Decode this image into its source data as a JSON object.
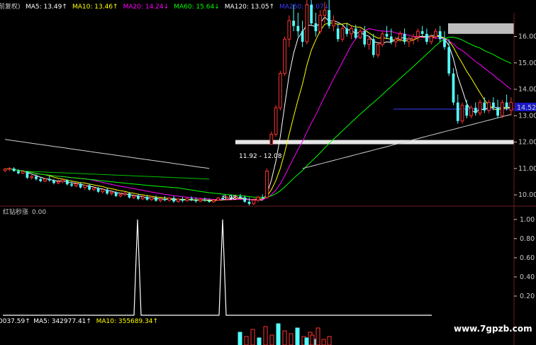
{
  "header": {
    "period_label": "前复权)",
    "ma_items": [
      {
        "label": "MA5: 13.49",
        "arrow": "↑",
        "color": "#ffffff"
      },
      {
        "label": "MA10: 13.46",
        "arrow": "↑",
        "color": "#ffff00"
      },
      {
        "label": "MA20: 14.24",
        "arrow": "↓",
        "color": "#ff00ff"
      },
      {
        "label": "MA60: 15.64",
        "arrow": "↓",
        "color": "#00ff00"
      },
      {
        "label": "MA120: 13.05",
        "arrow": "↑",
        "color": "#ffffff"
      },
      {
        "label": "MA250: 13.07",
        "arrow": "↓",
        "color": "#3b3bff"
      }
    ]
  },
  "price_axis": {
    "ticks": [
      "16.00",
      "15.00",
      "14.00",
      "13.00",
      "12.00",
      "11.00",
      "10.00"
    ],
    "current_price": "14.52",
    "range": [
      9.6,
      16.9
    ]
  },
  "annotations": {
    "low_label": "8.98",
    "gap_label": "11.92 - 12.08"
  },
  "indicator": {
    "title": "红钻秒涨",
    "value": "0.00",
    "ticks": [
      "1.00",
      "0.80",
      "0.60",
      "0.40",
      "0.20"
    ],
    "spikes": [
      {
        "bar_index": 38,
        "value": 1.0
      },
      {
        "bar_index": 62,
        "value": 1.0
      }
    ]
  },
  "volume": {
    "items": [
      {
        "label": "0037.59",
        "arrow": "↑",
        "color": "#ffffff"
      },
      {
        "label": "MA5: 342977.41",
        "arrow": "↑",
        "color": "#ffffff"
      },
      {
        "label": "MA10: 355689.34",
        "arrow": "↑",
        "color": "#ffff00"
      }
    ]
  },
  "watermark": "www.7gpzb.com",
  "chart_data": {
    "type": "candlestick",
    "colors": {
      "up": "#ff3232",
      "down": "#54fcfc",
      "ma5": "#ffffff",
      "ma10": "#ffff00",
      "ma20": "#ff00ff",
      "ma60": "#00ff00",
      "ma120": "#ffffff",
      "ma250": "#3b3bff"
    },
    "candles": [
      [
        10.92,
        11.02,
        10.86,
        10.98
      ],
      [
        10.98,
        11.06,
        10.9,
        11.0
      ],
      [
        11.0,
        11.05,
        10.88,
        10.9
      ],
      [
        10.9,
        10.98,
        10.78,
        10.82
      ],
      [
        10.82,
        10.94,
        10.8,
        10.88
      ],
      [
        10.88,
        10.9,
        10.6,
        10.65
      ],
      [
        10.65,
        10.75,
        10.58,
        10.7
      ],
      [
        10.7,
        10.78,
        10.55,
        10.6
      ],
      [
        10.6,
        10.68,
        10.48,
        10.52
      ],
      [
        10.52,
        10.64,
        10.48,
        10.6
      ],
      [
        10.6,
        10.7,
        10.5,
        10.55
      ],
      [
        10.55,
        10.6,
        10.4,
        10.45
      ],
      [
        10.45,
        10.58,
        10.4,
        10.5
      ],
      [
        10.5,
        10.62,
        10.44,
        10.56
      ],
      [
        10.56,
        10.6,
        10.36,
        10.4
      ],
      [
        10.4,
        10.5,
        10.3,
        10.35
      ],
      [
        10.35,
        10.46,
        10.28,
        10.42
      ],
      [
        10.42,
        10.48,
        10.24,
        10.28
      ],
      [
        10.28,
        10.4,
        10.2,
        10.36
      ],
      [
        10.36,
        10.42,
        10.16,
        10.2
      ],
      [
        10.2,
        10.32,
        10.14,
        10.26
      ],
      [
        10.26,
        10.3,
        10.08,
        10.12
      ],
      [
        10.12,
        10.24,
        10.05,
        10.2
      ],
      [
        10.2,
        10.26,
        10.0,
        10.05
      ],
      [
        10.05,
        10.18,
        9.98,
        10.1
      ],
      [
        10.1,
        10.15,
        9.92,
        9.96
      ],
      [
        9.96,
        10.08,
        9.9,
        10.02
      ],
      [
        10.02,
        10.12,
        9.95,
        10.06
      ],
      [
        10.06,
        10.1,
        9.86,
        9.9
      ],
      [
        9.9,
        10.02,
        9.84,
        9.96
      ],
      [
        9.96,
        10.05,
        9.8,
        9.85
      ],
      [
        9.85,
        9.98,
        9.8,
        9.92
      ],
      [
        9.92,
        10.0,
        9.78,
        9.82
      ],
      [
        9.82,
        9.96,
        9.78,
        9.9
      ],
      [
        9.9,
        9.98,
        9.74,
        9.78
      ],
      [
        9.78,
        9.9,
        9.72,
        9.84
      ],
      [
        9.84,
        9.95,
        9.76,
        9.8
      ],
      [
        9.8,
        9.92,
        9.74,
        9.88
      ],
      [
        9.88,
        9.96,
        9.7,
        9.75
      ],
      [
        9.75,
        9.88,
        9.7,
        9.84
      ],
      [
        9.84,
        9.92,
        9.72,
        9.78
      ],
      [
        9.78,
        9.9,
        9.74,
        9.86
      ],
      [
        9.86,
        9.94,
        9.76,
        9.8
      ],
      [
        9.8,
        9.9,
        9.7,
        9.76
      ],
      [
        9.76,
        9.88,
        9.72,
        9.82
      ],
      [
        9.82,
        9.9,
        9.74,
        9.78
      ],
      [
        9.78,
        9.86,
        9.7,
        9.74
      ],
      [
        9.74,
        9.84,
        9.7,
        9.8
      ],
      [
        9.8,
        9.92,
        9.76,
        9.88
      ],
      [
        9.88,
        9.98,
        9.8,
        9.84
      ],
      [
        9.84,
        9.96,
        9.78,
        9.9
      ],
      [
        9.9,
        10.0,
        9.82,
        9.86
      ],
      [
        9.86,
        9.98,
        9.8,
        9.94
      ],
      [
        9.94,
        10.04,
        9.86,
        9.9
      ],
      [
        9.9,
        9.98,
        9.7,
        9.74
      ],
      [
        9.74,
        9.9,
        9.6,
        9.66
      ],
      [
        9.66,
        9.86,
        9.62,
        9.8
      ],
      [
        9.8,
        9.96,
        9.72,
        9.92
      ],
      [
        9.92,
        10.02,
        9.84,
        9.9
      ],
      [
        9.9,
        11.0,
        9.88,
        10.9
      ],
      [
        11.92,
        12.4,
        11.9,
        12.3
      ],
      [
        12.3,
        13.4,
        12.2,
        13.3
      ],
      [
        13.3,
        14.7,
        13.2,
        14.6
      ],
      [
        14.6,
        16.0,
        14.5,
        15.9
      ],
      [
        15.9,
        16.8,
        15.6,
        16.6
      ],
      [
        16.6,
        17.2,
        16.2,
        16.4
      ],
      [
        16.4,
        16.9,
        16.0,
        16.2
      ],
      [
        16.2,
        16.6,
        15.6,
        15.8
      ],
      [
        15.8,
        17.4,
        15.7,
        17.2
      ],
      [
        17.2,
        17.6,
        16.4,
        16.5
      ],
      [
        16.5,
        16.9,
        16.0,
        16.2
      ],
      [
        16.2,
        17.0,
        16.1,
        16.8
      ],
      [
        16.8,
        17.3,
        16.5,
        17.0
      ],
      [
        17.0,
        17.4,
        16.3,
        16.4
      ],
      [
        16.4,
        16.8,
        16.2,
        16.6
      ],
      [
        16.3,
        16.5,
        15.8,
        15.9
      ],
      [
        15.9,
        16.4,
        15.8,
        16.3
      ],
      [
        16.3,
        16.5,
        16.0,
        16.1
      ],
      [
        16.1,
        16.4,
        15.9,
        16.3
      ],
      [
        16.3,
        16.45,
        15.9,
        15.95
      ],
      [
        15.95,
        16.3,
        15.9,
        16.2
      ],
      [
        16.2,
        16.4,
        15.6,
        15.7
      ],
      [
        15.7,
        16.0,
        15.5,
        15.9
      ],
      [
        15.9,
        16.1,
        15.2,
        15.3
      ],
      [
        15.3,
        15.8,
        15.2,
        15.7
      ],
      [
        15.7,
        16.2,
        15.6,
        16.1
      ],
      [
        16.1,
        16.4,
        15.9,
        16.0
      ],
      [
        16.0,
        16.3,
        15.7,
        15.8
      ],
      [
        15.8,
        16.0,
        15.6,
        15.9
      ],
      [
        15.9,
        16.2,
        15.8,
        16.1
      ],
      [
        16.1,
        16.3,
        15.7,
        15.8
      ],
      [
        15.8,
        16.0,
        15.6,
        15.9
      ],
      [
        15.9,
        16.1,
        15.7,
        16.0
      ],
      [
        16.0,
        16.3,
        15.8,
        16.2
      ],
      [
        16.2,
        16.4,
        16.0,
        16.1
      ],
      [
        16.1,
        16.3,
        15.7,
        15.8
      ],
      [
        15.8,
        16.1,
        15.7,
        16.0
      ],
      [
        16.0,
        16.3,
        15.9,
        16.2
      ],
      [
        16.2,
        16.4,
        15.8,
        15.9
      ],
      [
        15.9,
        16.2,
        15.5,
        15.6
      ],
      [
        15.6,
        15.9,
        14.5,
        14.6
      ],
      [
        14.6,
        14.8,
        13.4,
        13.5
      ],
      [
        13.5,
        13.8,
        12.7,
        12.8
      ],
      [
        12.8,
        13.5,
        12.7,
        13.4
      ],
      [
        13.4,
        13.6,
        12.9,
        13.0
      ],
      [
        13.0,
        13.4,
        12.9,
        13.3
      ],
      [
        13.3,
        13.5,
        13.0,
        13.1
      ],
      [
        13.1,
        13.6,
        13.0,
        13.5
      ],
      [
        13.5,
        13.7,
        13.1,
        13.2
      ],
      [
        13.2,
        13.6,
        13.1,
        13.5
      ],
      [
        13.5,
        13.7,
        13.2,
        13.3
      ],
      [
        13.3,
        13.6,
        12.9,
        13.0
      ],
      [
        13.0,
        13.6,
        12.9,
        13.5
      ],
      [
        13.5,
        13.8,
        13.2,
        13.3
      ],
      [
        13.2,
        13.7,
        13.0,
        13.5
      ]
    ],
    "x_start_label": "",
    "series": [
      {
        "name": "MA5",
        "values": [
          13.49
        ]
      },
      {
        "name": "MA10",
        "values": [
          13.46
        ]
      },
      {
        "name": "MA20",
        "values": [
          14.24
        ]
      },
      {
        "name": "MA60",
        "values": [
          15.64
        ]
      },
      {
        "name": "MA120",
        "values": [
          13.05
        ]
      },
      {
        "name": "MA250",
        "values": [
          13.07
        ]
      }
    ],
    "gap_zone": [
      11.92,
      12.08
    ],
    "resistance_zone": [
      16.1,
      16.5
    ],
    "support_line": 13.25,
    "indicator_series": {
      "name": "红钻秒涨",
      "spikes": [
        38,
        62
      ],
      "range": [
        0,
        1.05
      ]
    }
  }
}
